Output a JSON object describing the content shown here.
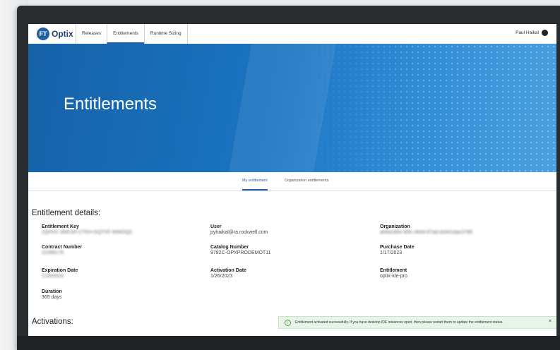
{
  "nav": {
    "logo_badge": "FT",
    "logo_text": "Optix",
    "tabs": [
      {
        "label": "Releases"
      },
      {
        "label": "Entitlements"
      },
      {
        "label": "Runtime Sizing"
      }
    ],
    "user_name": "Paul Haikal"
  },
  "hero": {
    "title": "Entitlements"
  },
  "subtabs": [
    {
      "label": "My entitlement"
    },
    {
      "label": "Organization entitlements"
    }
  ],
  "details": {
    "title": "Entitlement details:",
    "fields": {
      "entitlement_key": {
        "label": "Entitlement Key",
        "value": "2QHVC-3MC9X-CTKH-GQTXF-WWOQC"
      },
      "contract_number": {
        "label": "Contract Number",
        "value": "22396178"
      },
      "expiration_date": {
        "label": "Expiration Date",
        "value": "1/26/2024"
      },
      "duration": {
        "label": "Duration",
        "value": "365 days"
      },
      "user": {
        "label": "User",
        "value": "pyhaikal@ra.rockwell.com"
      },
      "catalog_number": {
        "label": "Catalog Number",
        "value": "9782C-OPXPRODEMOT11"
      },
      "activation_date": {
        "label": "Activation Date",
        "value": "1/26/2023"
      },
      "organization": {
        "label": "Organization",
        "value": "a64ac894-40fc-4644-87ad-dc641dae3788"
      },
      "purchase_date": {
        "label": "Purchase Date",
        "value": "1/17/2023"
      },
      "entitlement": {
        "label": "Entitlement",
        "value": "optix-ide-pro"
      }
    }
  },
  "activations": {
    "title": "Activations:"
  },
  "toast": {
    "message": "Entitlement activated successfully. If you have desktop IDE instances open, then please restart them to update the entitlement status.",
    "close": "×"
  },
  "colors": {
    "accent": "#1f5fa8",
    "hero": "#1a73c0",
    "toast_bg": "#e8f4e8"
  }
}
